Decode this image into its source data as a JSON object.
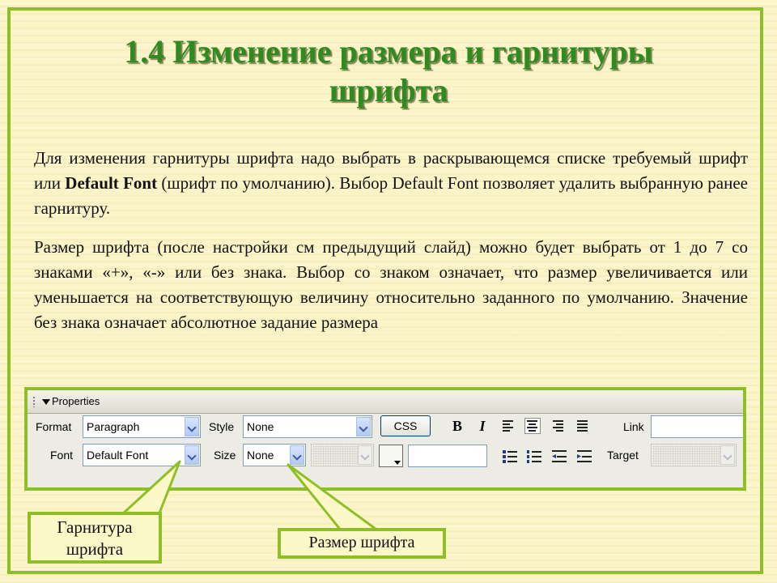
{
  "slide": {
    "title_line1": "1.4 Изменение размера и гарнитуры",
    "title_line2": "шрифта",
    "para1_a": "Для изменения гарнитуры шрифта надо выбрать в раскрывающемся списке требуемый шрифт или ",
    "para1_bold": "Default Font",
    "para1_b": " (шрифт по умолчанию). Выбор Default Font позволяет удалить выбранную ранее гарнитуру.",
    "para2": "Размер шрифта (после настройки см предыдущий слайд) можно будет выбрать от 1 до 7 со знаками «+», «-» или без знака. Выбор со знаком означает, что размер увеличивается или уменьшается на соответствующую величину относительно заданного по умолчанию. Значение без знака означает абсолютное задание размера"
  },
  "properties_panel": {
    "title": "Properties",
    "format_label": "Format",
    "format_value": "Paragraph",
    "style_label": "Style",
    "style_value": "None",
    "css_button": "CSS",
    "bold_glyph": "B",
    "italic_glyph": "I",
    "link_label": "Link",
    "font_label": "Font",
    "font_value": "Default Font",
    "size_label": "Size",
    "size_value": "None",
    "target_label": "Target"
  },
  "callouts": {
    "font_family": "Гарнитура шрифта",
    "font_size": "Размер шрифта"
  },
  "colors": {
    "frame_green": "#8fbf27",
    "title_green": "#2f8a1f",
    "background": "#fbf4c8"
  }
}
